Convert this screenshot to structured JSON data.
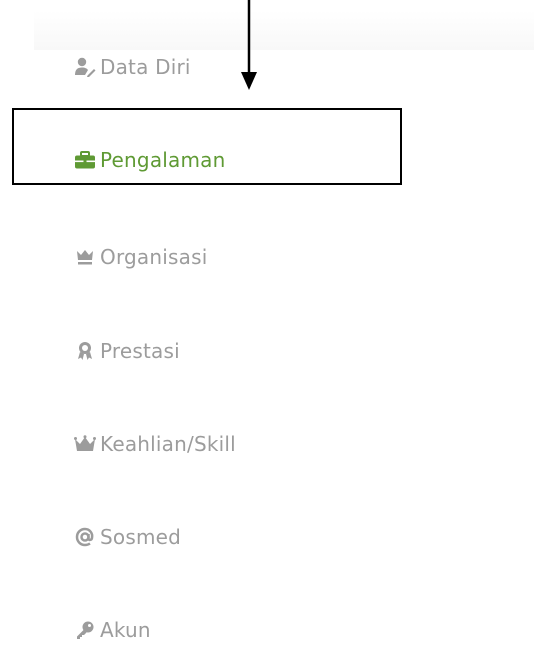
{
  "annotation": {
    "arrow_color": "#000000",
    "box_color": "#000000"
  },
  "menu": {
    "active_color": "#5f9a34",
    "inactive_color": "#9c9c9c",
    "items": [
      {
        "label": "Data Diri",
        "icon": "user-edit-icon",
        "active": false
      },
      {
        "label": "Pengalaman",
        "icon": "briefcase-icon",
        "active": true
      },
      {
        "label": "Organisasi",
        "icon": "crown-icon",
        "active": false
      },
      {
        "label": "Prestasi",
        "icon": "award-icon",
        "active": false
      },
      {
        "label": "Keahlian/Skill",
        "icon": "crown-skill-icon",
        "active": false
      },
      {
        "label": "Sosmed",
        "icon": "at-icon",
        "active": false
      },
      {
        "label": "Akun",
        "icon": "key-icon",
        "active": false
      }
    ]
  }
}
